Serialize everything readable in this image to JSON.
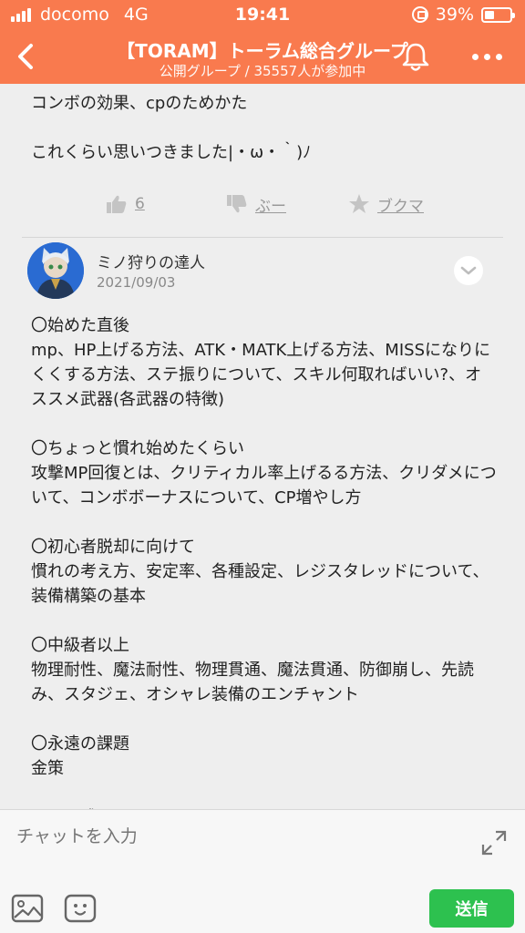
{
  "status_bar": {
    "carrier": "docomo",
    "network": "4G",
    "time": "19:41",
    "battery": "39%",
    "battery_level": 0.39
  },
  "header": {
    "title": "【TORAM】トーラム総合グループ",
    "subtitle": "公開グループ / 35557人が参加中"
  },
  "previous_post": {
    "partial_text": "〇〇",
    "text": "コンボの効果、cpのためかた\n\nこれくらい思いつきました|・ω・｀)ﾉ",
    "reactions": {
      "like_count": "6",
      "boo_label": "ぶー",
      "bookmark_label": "ブクマ"
    }
  },
  "post": {
    "author": "ミノ狩りの達人",
    "date": "2021/09/03",
    "body": "〇始めた直後\nmp、HP上げる方法、ATK・MATK上げる方法、MISSになりにくくする方法、ステ振りについて、スキル何取ればいい?、オススメ武器(各武器の特徴)\n\n〇ちょっと慣れ始めたくらい\n攻撃MP回復とは、クリティカル率上げるる方法、クリダメについて、コンボボーナスについて、CP増やし方\n\n〇初心者脱却に向けて\n慣れの考え方、安定率、各種設定、レジスタレッドについて、装備構築の基本\n\n〇中級者以上\n物理耐性、魔法耐性、物理貫通、魔法貫通、防御崩し、先読み、スタジェ、オシャレ装備のエンチャント\n\n〇永遠の課題\n金策\n\nこんな感じかなぁと思いました"
  },
  "input_bar": {
    "placeholder": "チャットを入力",
    "send_label": "送信"
  },
  "colors": {
    "header_bg": "#f97a4e",
    "send_bg": "#2dc14f",
    "content_bg": "#eeeeee"
  },
  "icons": [
    "signal-icon",
    "rotation-lock-icon",
    "battery-icon",
    "back-icon",
    "bell-icon",
    "more-icon",
    "thumbs-up-icon",
    "thumbs-down-icon",
    "star-icon",
    "chevron-down-icon",
    "fullscreen-icon",
    "image-icon",
    "stamp-icon"
  ]
}
